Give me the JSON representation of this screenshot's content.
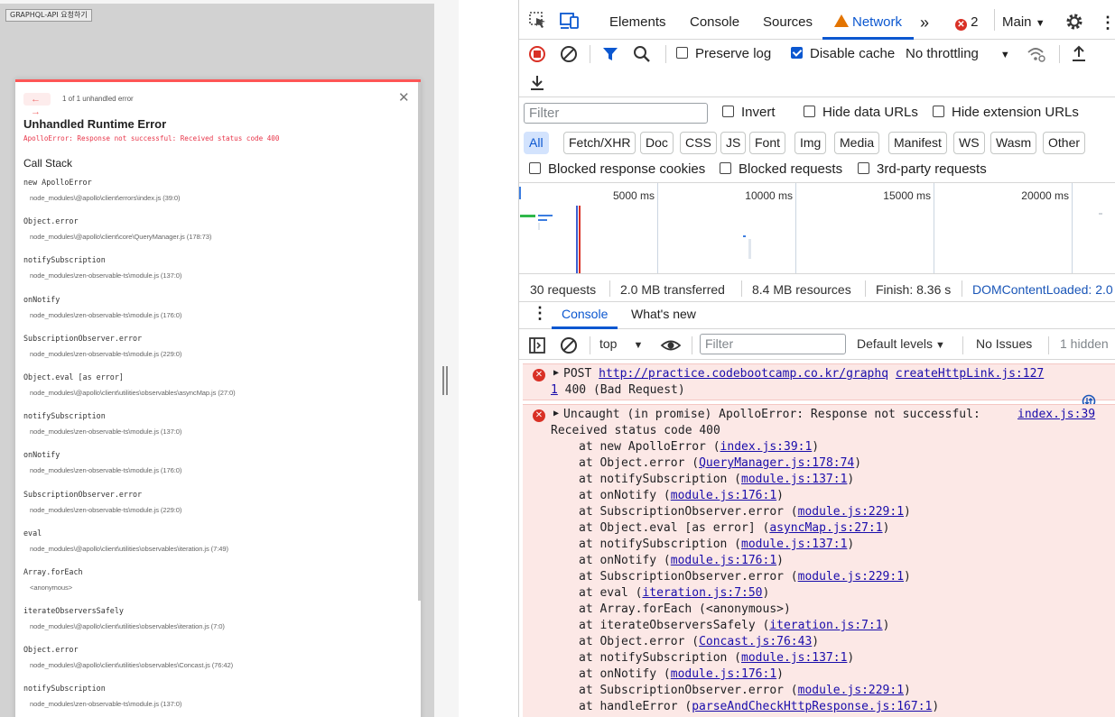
{
  "page": {
    "graphql_button": "GRAPHQL-API 요청하기"
  },
  "overlay": {
    "nav_arrows": "← →",
    "nav_count": "1 of 1 unhandled error",
    "title": "Unhandled Runtime Error",
    "message": "ApolloError: Response not successful: Received status code 400",
    "call_stack_title": "Call Stack",
    "frames": [
      {
        "fn": "new ApolloError",
        "loc": "node_modules\\@apollo\\client\\errors\\index.js (39:0)"
      },
      {
        "fn": "Object.error",
        "loc": "node_modules\\@apollo\\client\\core\\QueryManager.js (178:73)"
      },
      {
        "fn": "notifySubscription",
        "loc": "node_modules\\zen-observable-ts\\module.js (137:0)"
      },
      {
        "fn": "onNotify",
        "loc": "node_modules\\zen-observable-ts\\module.js (176:0)"
      },
      {
        "fn": "SubscriptionObserver.error",
        "loc": "node_modules\\zen-observable-ts\\module.js (229:0)"
      },
      {
        "fn": "Object.eval [as error]",
        "loc": "node_modules\\@apollo\\client\\utilities\\observables\\asyncMap.js (27:0)"
      },
      {
        "fn": "notifySubscription",
        "loc": "node_modules\\zen-observable-ts\\module.js (137:0)"
      },
      {
        "fn": "onNotify",
        "loc": "node_modules\\zen-observable-ts\\module.js (176:0)"
      },
      {
        "fn": "SubscriptionObserver.error",
        "loc": "node_modules\\zen-observable-ts\\module.js (229:0)"
      },
      {
        "fn": "eval",
        "loc": "node_modules\\@apollo\\client\\utilities\\observables\\iteration.js (7:49)"
      },
      {
        "fn": "Array.forEach",
        "loc": "<anonymous>"
      },
      {
        "fn": "iterateObserversSafely",
        "loc": "node_modules\\@apollo\\client\\utilities\\observables\\iteration.js (7:0)"
      },
      {
        "fn": "Object.error",
        "loc": "node_modules\\@apollo\\client\\utilities\\observables\\Concast.js (76:42)"
      },
      {
        "fn": "notifySubscription",
        "loc": "node_modules\\zen-observable-ts\\module.js (137:0)"
      }
    ]
  },
  "devtools": {
    "tabs": [
      "Elements",
      "Console",
      "Sources",
      "Network"
    ],
    "active_tab": "Network",
    "more": "»",
    "error_count": "2",
    "target": "Main",
    "toolbar": {
      "preserve_log": "Preserve log",
      "disable_cache": "Disable cache",
      "throttling": "No throttling"
    },
    "filter": {
      "placeholder": "Filter",
      "invert": "Invert",
      "hide_data_urls": "Hide data URLs",
      "hide_extension_urls": "Hide extension URLs"
    },
    "type_filters": [
      "All",
      "Fetch/XHR",
      "Doc",
      "CSS",
      "JS",
      "Font",
      "Img",
      "Media",
      "Manifest",
      "WS",
      "Wasm",
      "Other"
    ],
    "blocked": {
      "cookies": "Blocked response cookies",
      "requests": "Blocked requests",
      "third_party": "3rd-party requests"
    },
    "overview_ticks": [
      "5000 ms",
      "10000 ms",
      "15000 ms",
      "20000 ms"
    ],
    "status": {
      "requests": "30 requests",
      "transferred": "2.0 MB transferred",
      "resources": "8.4 MB resources",
      "finish": "Finish: 8.36 s",
      "dcl": "DOMContentLoaded: 2.0"
    },
    "drawer_tabs": [
      "Console",
      "What's new"
    ],
    "console_toolbar": {
      "context": "top",
      "filter_placeholder": "Filter",
      "levels": "Default levels",
      "issues": "No Issues",
      "hidden": "1 hidden"
    },
    "messages": {
      "post": {
        "prefix": "POST",
        "url": "http://practice.codebootcamp.co.kr/graphq",
        "source": "createHttpLink.js:127",
        "line2_link": "1",
        "line2_text": " 400 (Bad Request)"
      },
      "uncaught": {
        "text": "Uncaught (in promise) ApolloError: Response not successful:",
        "source": "index.js:39",
        "line2": "Received status code 400",
        "stack": [
          {
            "pre": "at new ApolloError (",
            "link": "index.js:39:1",
            "post": ")"
          },
          {
            "pre": "at Object.error (",
            "link": "QueryManager.js:178:74",
            "post": ")"
          },
          {
            "pre": "at notifySubscription (",
            "link": "module.js:137:1",
            "post": ")"
          },
          {
            "pre": "at onNotify (",
            "link": "module.js:176:1",
            "post": ")"
          },
          {
            "pre": "at SubscriptionObserver.error (",
            "link": "module.js:229:1",
            "post": ")"
          },
          {
            "pre": "at Object.eval [as error] (",
            "link": "asyncMap.js:27:1",
            "post": ")"
          },
          {
            "pre": "at notifySubscription (",
            "link": "module.js:137:1",
            "post": ")"
          },
          {
            "pre": "at onNotify (",
            "link": "module.js:176:1",
            "post": ")"
          },
          {
            "pre": "at SubscriptionObserver.error (",
            "link": "module.js:229:1",
            "post": ")"
          },
          {
            "pre": "at eval (",
            "link": "iteration.js:7:50",
            "post": ")"
          },
          {
            "pre": "at Array.forEach (<anonymous>)",
            "link": "",
            "post": ""
          },
          {
            "pre": "at iterateObserversSafely (",
            "link": "iteration.js:7:1",
            "post": ")"
          },
          {
            "pre": "at Object.error (",
            "link": "Concast.js:76:43",
            "post": ")"
          },
          {
            "pre": "at notifySubscription (",
            "link": "module.js:137:1",
            "post": ")"
          },
          {
            "pre": "at onNotify (",
            "link": "module.js:176:1",
            "post": ")"
          },
          {
            "pre": "at SubscriptionObserver.error (",
            "link": "module.js:229:1",
            "post": ")"
          },
          {
            "pre": "at handleError (",
            "link": "parseAndCheckHttpResponse.js:167:1",
            "post": ")"
          }
        ]
      }
    },
    "colors": {
      "accent": "#0b57d0",
      "error": "#d93025",
      "error_bg": "#fce8e6",
      "overlay_red": "#e8364a"
    }
  }
}
